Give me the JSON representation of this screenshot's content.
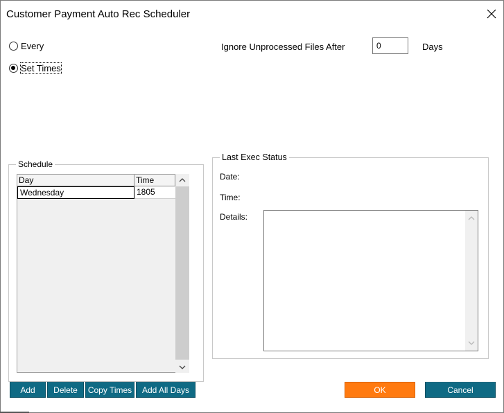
{
  "window": {
    "title": "Customer Payment Auto Rec Scheduler"
  },
  "mode": {
    "every_label": "Every",
    "set_times_label": "Set Times",
    "selected": "Set Times"
  },
  "ignore": {
    "label": "Ignore Unprocessed Files After",
    "value": "0",
    "unit": "Days"
  },
  "schedule": {
    "legend": "Schedule",
    "columns": [
      "Day",
      "Time"
    ],
    "rows": [
      {
        "day": "Wednesday",
        "time": "1805"
      }
    ]
  },
  "last_exec": {
    "legend": "Last Exec Status",
    "date_label": "Date:",
    "time_label": "Time:",
    "details_label": "Details:"
  },
  "buttons": {
    "add": "Add",
    "delete": "Delete",
    "copy_times": "Copy Times",
    "add_all_days": "Add All Days",
    "ok": "OK",
    "cancel": "Cancel"
  },
  "colors": {
    "teal_button": "#0f6a84",
    "orange_button": "#ff7a10"
  },
  "icons": [
    "close-icon",
    "scroll-up-icon",
    "scroll-down-icon"
  ]
}
